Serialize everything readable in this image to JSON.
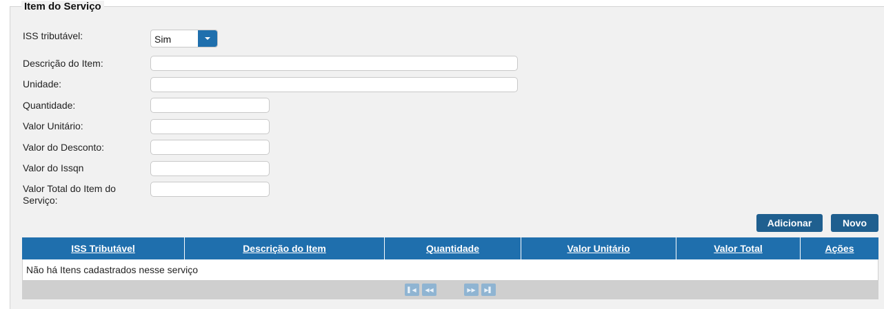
{
  "section": {
    "title": "Item do Serviço"
  },
  "form": {
    "iss_tributavel_label": "ISS tributável:",
    "iss_tributavel_value": "Sim",
    "descricao_label": "Descrição do Item:",
    "descricao_value": "",
    "unidade_label": "Unidade:",
    "unidade_value": "",
    "quantidade_label": "Quantidade:",
    "quantidade_value": "",
    "valor_unitario_label": "Valor Unitário:",
    "valor_unitario_value": "",
    "valor_desconto_label": "Valor do Desconto:",
    "valor_desconto_value": "",
    "valor_issqn_label": "Valor do Issqn",
    "valor_issqn_value": "",
    "valor_total_label_line1": "Valor Total do Item do",
    "valor_total_label_line2": "Serviço:",
    "valor_total_value": ""
  },
  "actions": {
    "adicionar": "Adicionar",
    "novo": "Novo"
  },
  "table": {
    "columns": [
      "ISS Tributável",
      "Descrição do Item",
      "Quantidade",
      "Valor Unitário",
      "Valor Total",
      "Ações"
    ],
    "empty_message": "Não há Itens cadastrados nesse serviço"
  },
  "pager": {
    "first": "first-page-icon",
    "prev": "prev-page-icon",
    "next": "next-page-icon",
    "last": "last-page-icon"
  },
  "colors": {
    "header_blue": "#1f6fad",
    "button_blue": "#1f5f8f",
    "panel_bg": "#f1f1f1"
  }
}
